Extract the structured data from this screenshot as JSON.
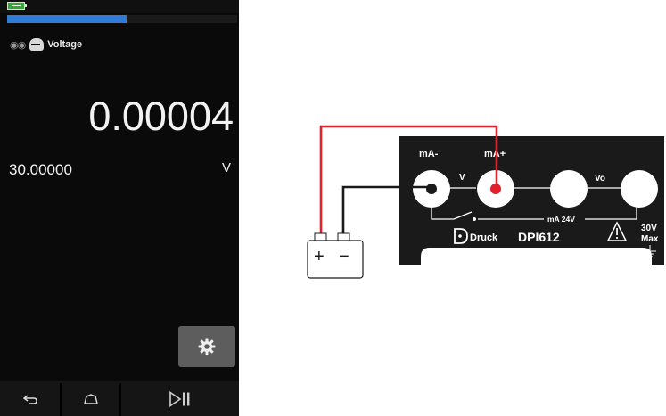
{
  "device": {
    "progress_fraction": 0.52,
    "status": {
      "battery_icon": "battery-icon"
    },
    "channel": {
      "sensor_icon": "sensor-icon",
      "function_icon": "measure-icon",
      "function_label": "Voltage"
    },
    "reading": "0.00004",
    "range_value": "30.00000",
    "units": "V",
    "buttons": {
      "settings_icon": "gear-icon",
      "back_icon": "back-icon",
      "home_icon": "home-icon",
      "play_pause_icon": "play-pause-icon"
    }
  },
  "diagram": {
    "terminals": {
      "ma_minus": "mA-",
      "ma_plus": "mA+",
      "v": "V",
      "vo": "Vo",
      "ma_24v": "mA 24V"
    },
    "brand": "Druck",
    "model": "DPI612",
    "warning_voltage": "30V",
    "warning_max": "Max",
    "battery": {
      "plus": "+",
      "minus": "−"
    },
    "colors": {
      "positive_lead": "#e0202a",
      "negative_lead": "#1a1a1a",
      "panel": "#1a1a1a"
    }
  }
}
